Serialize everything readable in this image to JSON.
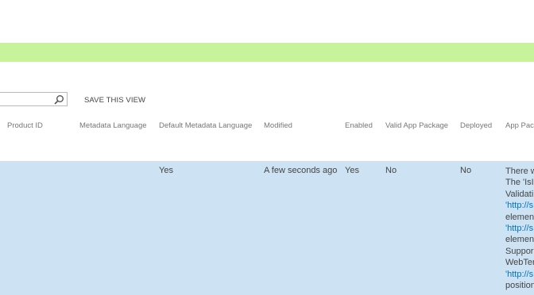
{
  "toolbar": {
    "search_placeholder": "",
    "save_view_label": "SAVE THIS VIEW"
  },
  "table": {
    "columns": [
      "Product ID",
      "Metadata Language",
      "Default Metadata Language",
      "Modified",
      "Enabled",
      "Valid App Package",
      "Deployed",
      "App Pack"
    ],
    "row": {
      "product_id": "",
      "metadata_language": "",
      "default_metadata_language": "Yes",
      "modified": "A few seconds ago",
      "enabled": "Yes",
      "valid_app_package": "No",
      "deployed": "No",
      "app_package_error_lines": [
        "There w",
        "The 'IsI",
        "Validati",
        "'http://s",
        "elemen",
        "'http://s",
        "elemen",
        "Suppor",
        "WebTer",
        "'http://s",
        "position"
      ]
    }
  },
  "colors": {
    "status_bar": "#c7f39a",
    "selected_row": "#cde3f4",
    "link": "#0072c6"
  }
}
